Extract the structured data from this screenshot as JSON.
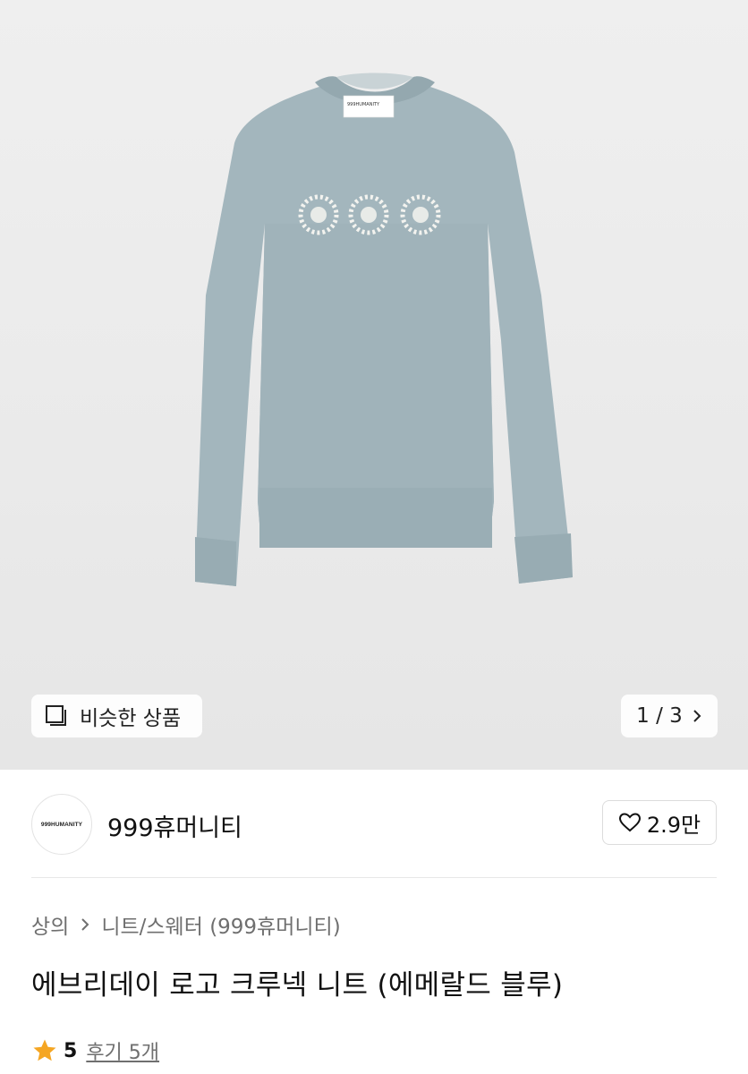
{
  "hero": {
    "product_label_text": "999HUMANITY",
    "similar_button_label": "비슷한 상품",
    "image_counter": "1 / 3"
  },
  "seller": {
    "avatar_text": "999HUMANITY",
    "name": "999휴머니티",
    "like_count": "2.9만"
  },
  "breadcrumb": {
    "category": "상의",
    "subcategory": "니트/스웨터 (999휴머니티)"
  },
  "product": {
    "title": "에브리데이 로고 크루넥 니트 (에메랄드 블루)",
    "rating": "5",
    "reviews": "후기 5개"
  },
  "colors": {
    "sweater": "#9fb3bb",
    "star": "#f5a623"
  },
  "icons": [
    "similar-items-icon",
    "chevron-right-icon",
    "heart-outline-icon",
    "star-icon"
  ]
}
